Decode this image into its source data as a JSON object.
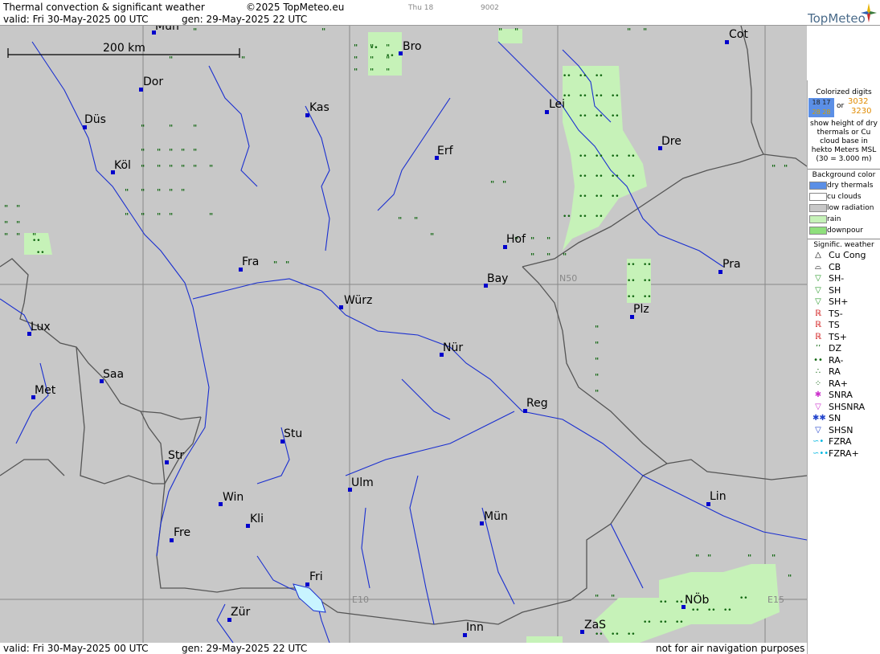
{
  "header": {
    "title": "Thermal convection & significant weather",
    "copyright": "©2025 TopMeteo.eu",
    "day": "Thu 18",
    "code": "9002",
    "valid": "valid:  Fri  30-May-2025  00 UTC",
    "generated": "gen: 29-May-2025 22 UTC",
    "logo": "TopMeteo"
  },
  "footer": {
    "valid": "valid:  Fri  30-May-2025  00 UTC",
    "generated": "gen: 29-May-2025 22 UTC",
    "disclaimer": "not for air navigation purposes"
  },
  "map": {
    "scale_label": "200 km",
    "grid_labels": {
      "n50": "N50",
      "e10": "E10",
      "e15": "E15"
    },
    "cities": [
      {
        "name": "Mün",
        "key": "mun_n"
      },
      {
        "name": "Bro",
        "key": "bro"
      },
      {
        "name": "Cot",
        "key": "cot"
      },
      {
        "name": "Dor",
        "key": "dor"
      },
      {
        "name": "Kas",
        "key": "kas"
      },
      {
        "name": "Lei",
        "key": "lei"
      },
      {
        "name": "Düs",
        "key": "dus"
      },
      {
        "name": "Erf",
        "key": "erf"
      },
      {
        "name": "Dre",
        "key": "dre"
      },
      {
        "name": "Köl",
        "key": "kol"
      },
      {
        "name": "Hof",
        "key": "hof"
      },
      {
        "name": "Fra",
        "key": "fra"
      },
      {
        "name": "Pra",
        "key": "pra"
      },
      {
        "name": "Bay",
        "key": "bay"
      },
      {
        "name": "Würz",
        "key": "wur"
      },
      {
        "name": "Plz",
        "key": "plz"
      },
      {
        "name": "Lux",
        "key": "lux"
      },
      {
        "name": "Nür",
        "key": "nur"
      },
      {
        "name": "Saa",
        "key": "saa"
      },
      {
        "name": "Met",
        "key": "met"
      },
      {
        "name": "Reg",
        "key": "reg"
      },
      {
        "name": "Stu",
        "key": "stu"
      },
      {
        "name": "Str",
        "key": "str"
      },
      {
        "name": "Ulm",
        "key": "ulm"
      },
      {
        "name": "Lin",
        "key": "lin"
      },
      {
        "name": "Win",
        "key": "win"
      },
      {
        "name": "Mün",
        "key": "mun"
      },
      {
        "name": "Kli",
        "key": "kli"
      },
      {
        "name": "Fre",
        "key": "fre"
      },
      {
        "name": "Fri",
        "key": "fri"
      },
      {
        "name": "NÖb",
        "key": "nob"
      },
      {
        "name": "Zür",
        "key": "zur"
      },
      {
        "name": "ZaS",
        "key": "zas"
      },
      {
        "name": "Inn",
        "key": "inn"
      }
    ]
  },
  "legend": {
    "colorized_title": "Colorized digits",
    "sample_a": "18 17",
    "sample_b": "28 28",
    "or": "or",
    "sample_c": "3032",
    "sample_d": "3230",
    "explain": "show height of dry thermals or Cu cloud base in hekto Meters MSL (30 = 3.000 m)",
    "bg_title": "Background color",
    "bg_items": [
      {
        "label": "dry thermals",
        "color": "#5b8fe6"
      },
      {
        "label": "cu clouds",
        "color": "#ffffff"
      },
      {
        "label": "low radiation",
        "color": "#c8c8c8"
      },
      {
        "label": "rain",
        "color": "#c6f2b8"
      },
      {
        "label": "downpour",
        "color": "#8fe07c"
      }
    ],
    "sig_title": "Signific. weather",
    "sig_items": [
      {
        "label": "Cu Cong",
        "icon": "cu-cong-icon",
        "glyph": "△",
        "color": "#000"
      },
      {
        "label": "CB",
        "icon": "cb-icon",
        "glyph": "⌓",
        "color": "#000"
      },
      {
        "label": "SH-",
        "icon": "shower-light-icon",
        "glyph": "▽",
        "color": "#2a9a2a"
      },
      {
        "label": "SH",
        "icon": "shower-icon",
        "glyph": "▽",
        "color": "#2a9a2a"
      },
      {
        "label": "SH+",
        "icon": "shower-heavy-icon",
        "glyph": "▽",
        "color": "#2a9a2a"
      },
      {
        "label": "TS-",
        "icon": "thunder-light-icon",
        "glyph": "ℝ",
        "color": "#d01010"
      },
      {
        "label": "TS",
        "icon": "thunder-icon",
        "glyph": "ℝ",
        "color": "#d01010"
      },
      {
        "label": "TS+",
        "icon": "thunder-heavy-icon",
        "glyph": "ℝ",
        "color": "#d01010"
      },
      {
        "label": "DZ",
        "icon": "drizzle-icon",
        "glyph": "’’",
        "color": "#116611"
      },
      {
        "label": "RA-",
        "icon": "rain-light-icon",
        "glyph": "••",
        "color": "#116611"
      },
      {
        "label": "RA",
        "icon": "rain-icon",
        "glyph": "∴",
        "color": "#116611"
      },
      {
        "label": "RA+",
        "icon": "rain-heavy-icon",
        "glyph": "⁘",
        "color": "#116611"
      },
      {
        "label": "SNRA",
        "icon": "snow-rain-icon",
        "glyph": "✱",
        "color": "#cc33cc"
      },
      {
        "label": "SHSNRA",
        "icon": "shower-snow-rain-icon",
        "glyph": "▽",
        "color": "#cc33cc"
      },
      {
        "label": "SN",
        "icon": "snow-icon",
        "glyph": "✱✱",
        "color": "#2244cc"
      },
      {
        "label": "SHSN",
        "icon": "shower-snow-icon",
        "glyph": "▽",
        "color": "#2244cc"
      },
      {
        "label": "FZRA",
        "icon": "freezing-rain-icon",
        "glyph": "∽•",
        "color": "#00b7e0"
      },
      {
        "label": "FZRA+",
        "icon": "freezing-rain-heavy-icon",
        "glyph": "∽••",
        "color": "#00b7e0"
      }
    ]
  }
}
